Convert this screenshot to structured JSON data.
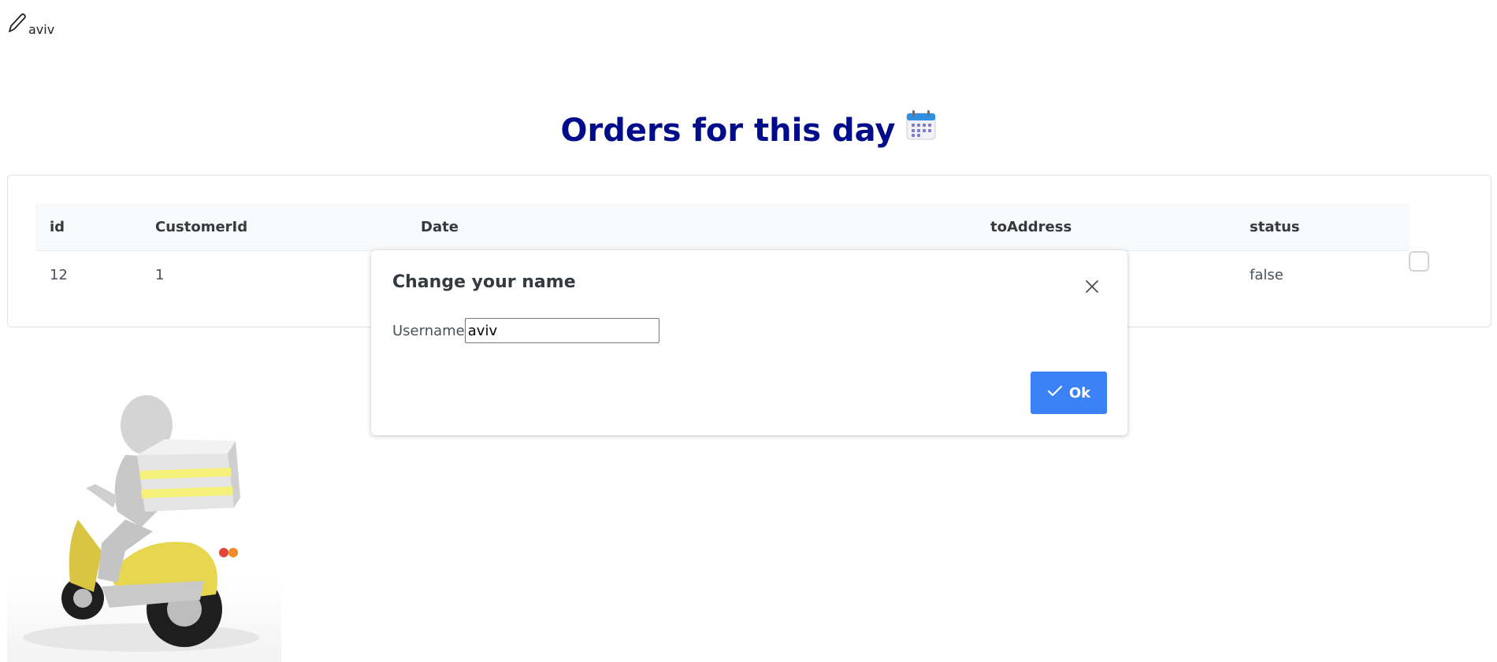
{
  "header": {
    "user_name": "aviv",
    "edit_icon": "pencil-icon"
  },
  "page": {
    "title": "Orders for this day",
    "title_icon": "calendar-icon",
    "title_color": "#010c8a"
  },
  "table": {
    "columns": [
      "id",
      "CustomerId",
      "Date",
      "toAddress",
      "status"
    ],
    "rows": [
      {
        "id": "12",
        "customer_id": "1",
        "date": "",
        "to_address": "",
        "status": "false"
      }
    ]
  },
  "dialog": {
    "title": "Change your name",
    "username_label": "Username",
    "username_value": "aviv",
    "ok_label": "Ok",
    "ok_icon": "check-icon",
    "close_icon": "close-icon",
    "accent_color": "#3b82f6"
  },
  "illustration": {
    "icon": "delivery-scooter-illustration"
  }
}
